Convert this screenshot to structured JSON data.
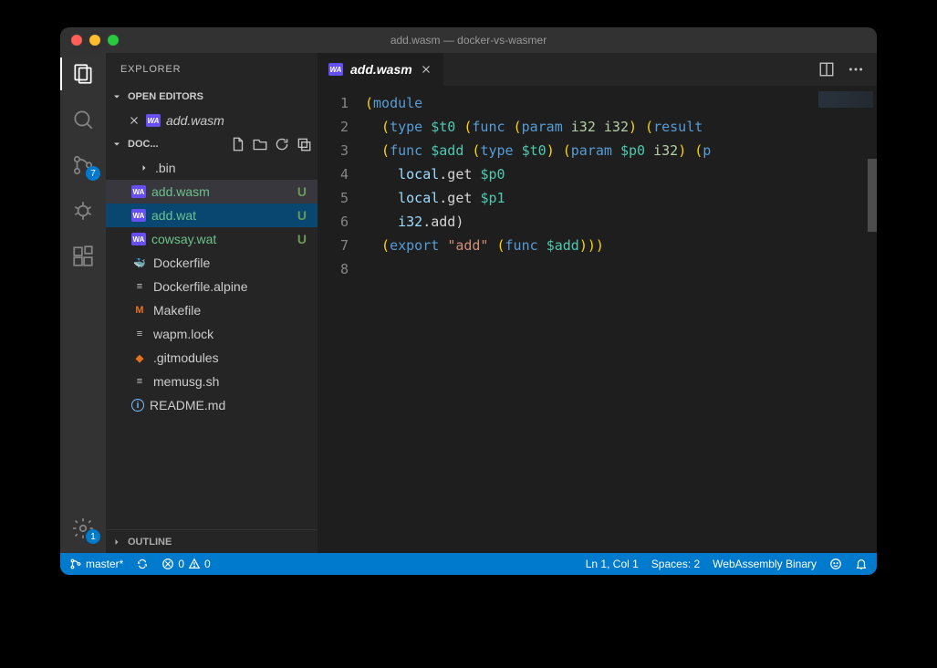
{
  "titlebar": {
    "title": "add.wasm — docker-vs-wasmer"
  },
  "activitybar": {
    "scm_badge": "7",
    "gear_badge": "1"
  },
  "sidebar": {
    "title": "EXPLORER",
    "open_editors": {
      "label": "OPEN EDITORS",
      "items": [
        {
          "name": "add.wasm",
          "icon": "wa"
        }
      ]
    },
    "folder": {
      "label": "DOC...",
      "items": [
        {
          "name": ".bin",
          "type": "folder",
          "depth": 1
        },
        {
          "name": "add.wasm",
          "icon": "wa",
          "status": "U",
          "untracked": true,
          "selected": true
        },
        {
          "name": "add.wat",
          "icon": "wa",
          "status": "U",
          "untracked": true,
          "focused": true
        },
        {
          "name": "cowsay.wat",
          "icon": "wa",
          "status": "U",
          "untracked": true
        },
        {
          "name": "Dockerfile",
          "icon": "dk"
        },
        {
          "name": "Dockerfile.alpine",
          "icon": "txt"
        },
        {
          "name": "Makefile",
          "icon": "mk"
        },
        {
          "name": "wapm.lock",
          "icon": "txt"
        },
        {
          "name": ".gitmodules",
          "icon": "git"
        },
        {
          "name": "memusg.sh",
          "icon": "txt"
        },
        {
          "name": "README.md",
          "icon": "info"
        }
      ]
    },
    "outline_label": "OUTLINE"
  },
  "editor": {
    "tab": {
      "name": "add.wasm",
      "icon": "wa"
    },
    "lines": [
      [
        {
          "t": "(",
          "c": "punc"
        },
        {
          "t": "module",
          "c": "kw"
        }
      ],
      [
        {
          "t": "  (",
          "c": "punc"
        },
        {
          "t": "type",
          "c": "kw"
        },
        {
          "t": " "
        },
        {
          "t": "$t0",
          "c": "var"
        },
        {
          "t": " (",
          "c": "punc"
        },
        {
          "t": "func",
          "c": "kw"
        },
        {
          "t": " (",
          "c": "punc"
        },
        {
          "t": "param",
          "c": "kw"
        },
        {
          "t": " "
        },
        {
          "t": "i32 i32",
          "c": "type"
        },
        {
          "t": ") (",
          "c": "punc"
        },
        {
          "t": "result",
          "c": "kw"
        }
      ],
      [
        {
          "t": "  (",
          "c": "punc"
        },
        {
          "t": "func",
          "c": "kw"
        },
        {
          "t": " "
        },
        {
          "t": "$add",
          "c": "var"
        },
        {
          "t": " (",
          "c": "punc"
        },
        {
          "t": "type",
          "c": "kw"
        },
        {
          "t": " "
        },
        {
          "t": "$t0",
          "c": "var"
        },
        {
          "t": ") (",
          "c": "punc"
        },
        {
          "t": "param",
          "c": "kw"
        },
        {
          "t": " "
        },
        {
          "t": "$p0",
          "c": "var"
        },
        {
          "t": " "
        },
        {
          "t": "i32",
          "c": "type"
        },
        {
          "t": ") (",
          "c": "punc"
        },
        {
          "t": "p",
          "c": "kw"
        }
      ],
      [
        {
          "t": "    "
        },
        {
          "t": "local",
          "c": "fn"
        },
        {
          "t": ".get ",
          "c": "op"
        },
        {
          "t": "$p0",
          "c": "var"
        }
      ],
      [
        {
          "t": "    "
        },
        {
          "t": "local",
          "c": "fn"
        },
        {
          "t": ".get ",
          "c": "op"
        },
        {
          "t": "$p1",
          "c": "var"
        }
      ],
      [
        {
          "t": "    "
        },
        {
          "t": "i32",
          "c": "fn"
        },
        {
          "t": ".add)",
          "c": "op"
        }
      ],
      [
        {
          "t": "  (",
          "c": "punc"
        },
        {
          "t": "export",
          "c": "kw"
        },
        {
          "t": " "
        },
        {
          "t": "\"add\"",
          "c": "str"
        },
        {
          "t": " (",
          "c": "punc"
        },
        {
          "t": "func",
          "c": "kw"
        },
        {
          "t": " "
        },
        {
          "t": "$add",
          "c": "var"
        },
        {
          "t": "))",
          "c": "punc"
        },
        {
          "t": ")",
          "c": "punc"
        }
      ],
      [
        {
          "t": " "
        }
      ]
    ]
  },
  "statusbar": {
    "branch": "master*",
    "errors": "0",
    "warnings": "0",
    "position": "Ln 1, Col 1",
    "spaces": "Spaces: 2",
    "language": "WebAssembly Binary"
  }
}
